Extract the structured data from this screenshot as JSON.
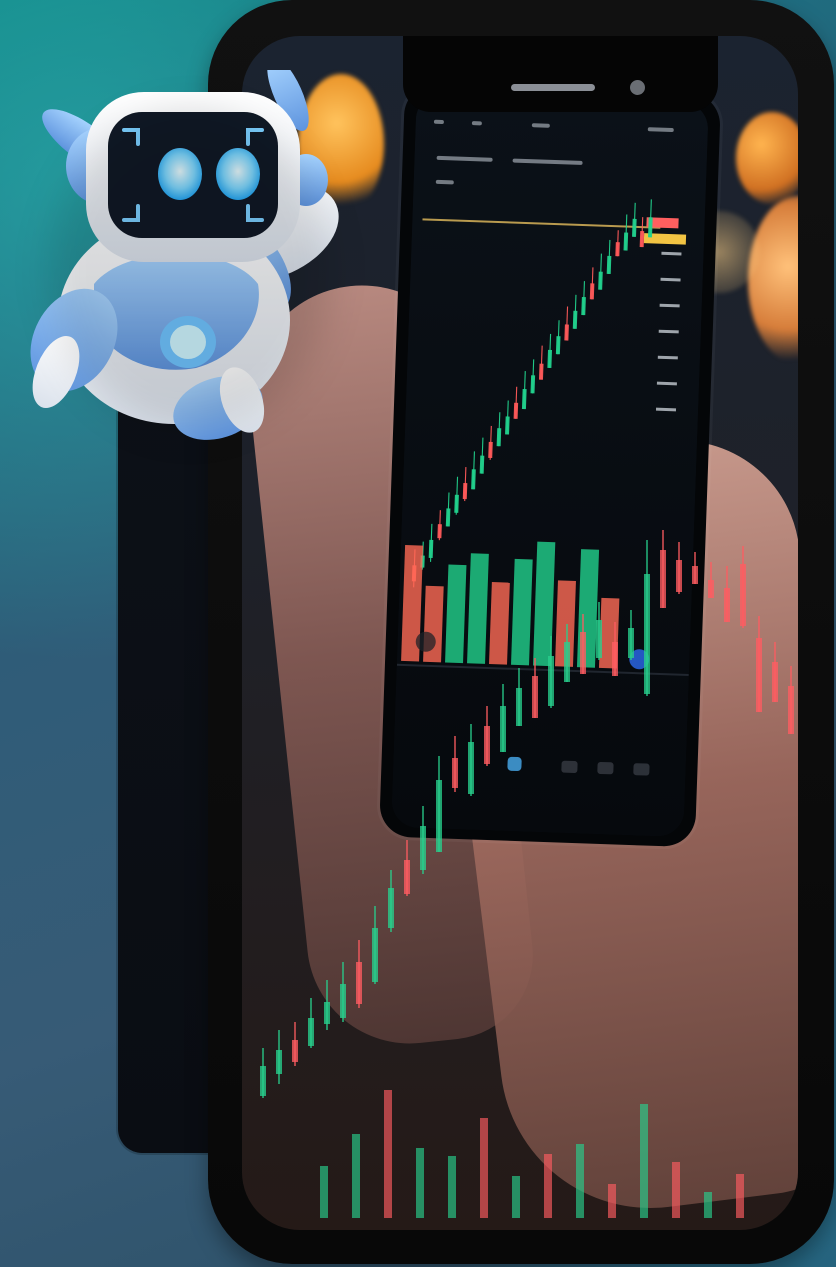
{
  "scene": {
    "background_colors": [
      "#127f82",
      "#375b76",
      "#2b4f66"
    ],
    "accent_colors": {
      "green_candle": "#25d18d",
      "red_candle": "#ff5266",
      "robot_blue": "#78b7f6",
      "robot_face": "#0d1725",
      "phone_black": "#0a0a0a"
    },
    "icons": {
      "robot": "robot-mascot",
      "phone": "phone-mockup",
      "chart": "candlestick-chart"
    }
  }
}
